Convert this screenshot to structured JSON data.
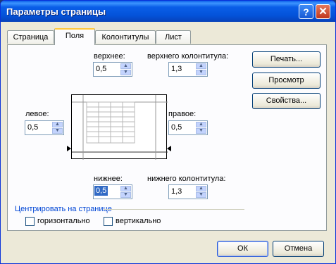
{
  "dialog": {
    "title": "Параметры страницы",
    "help_glyph": "?",
    "close_glyph": "✕"
  },
  "tabs": [
    {
      "label": "Страница"
    },
    {
      "label": "Поля"
    },
    {
      "label": "Колонтитулы"
    },
    {
      "label": "Лист"
    }
  ],
  "active_tab": "Поля",
  "margins": {
    "top": {
      "label": "верхнее:",
      "value": "0,5"
    },
    "header": {
      "label": "верхнего колонтитула:",
      "value": "1,3"
    },
    "left": {
      "label": "левое:",
      "value": "0,5"
    },
    "right": {
      "label": "правое:",
      "value": "0,5"
    },
    "bottom": {
      "label": "нижнее:",
      "value": "0,5"
    },
    "footer": {
      "label": "нижнего колонтитула:",
      "value": "1,3"
    }
  },
  "side_buttons": {
    "print": "Печать...",
    "preview": "Просмотр",
    "properties": "Свойства..."
  },
  "center": {
    "group_label": "Центрировать на странице",
    "horizontal": {
      "label": "горизонтально",
      "checked": false
    },
    "vertical": {
      "label": "вертикально",
      "checked": false
    }
  },
  "footer_buttons": {
    "ok": "ОК",
    "cancel": "Отмена"
  }
}
